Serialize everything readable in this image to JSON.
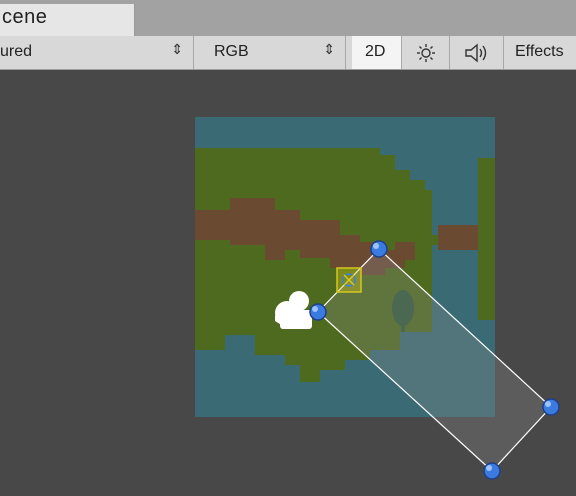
{
  "window": {
    "tab_title": "cene"
  },
  "toolbar": {
    "draw_mode": "ured",
    "color_mode": "RGB",
    "mode_2d": "2D",
    "lighting_icon": "sun-icon",
    "audio_icon": "speaker-icon",
    "effects_label": "Effects"
  },
  "scene": {
    "background_color": "#484848",
    "water_color": "#3a6a74",
    "grass_color": "#4e6a1e",
    "dirt_color": "#6b4a32",
    "tree_color": "#2f5a3a",
    "camera_icon": "camera-gizmo-icon",
    "handle_icon": "blue-handle-icon",
    "pivot_icon": "pivot-icon"
  }
}
